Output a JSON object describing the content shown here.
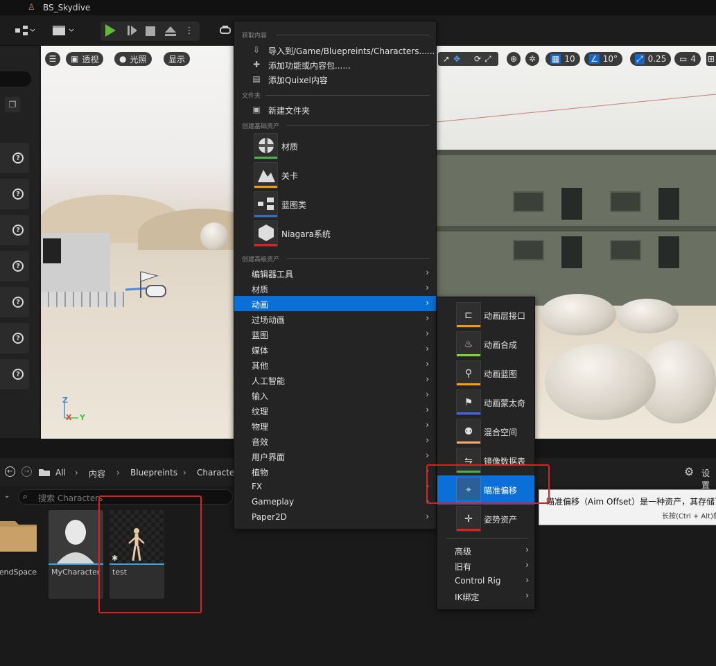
{
  "window": {
    "title": "BS_Skydive"
  },
  "viewport": {
    "menu_icon": "hamburger-icon",
    "perspective_label": "透视",
    "lighting_label": "光照",
    "show_label": "显示",
    "grid_value": "10",
    "angle_value": "10°",
    "scale_value": "0.25",
    "camera_value": "4",
    "axis_z": "Z",
    "axis_x": "X",
    "axis_y": "Y"
  },
  "content_browser": {
    "breadcrumb": [
      "All",
      "内容",
      "Bluepreints",
      "Characte"
    ],
    "settings_label": "设置",
    "search_placeholder": "搜索 Characters",
    "assets": [
      {
        "label": "BlendSpace"
      },
      {
        "label": "MyCharacter"
      },
      {
        "label": "test"
      }
    ]
  },
  "context_menu": {
    "section_get": "获取内容",
    "import_label": "导入到/Game/Bluepreints/Characters......",
    "add_feature_label": "添加功能或内容包......",
    "add_quixel_label": "添加Quixel内容",
    "section_folder": "文件夹",
    "new_folder_label": "新建文件夹",
    "section_basic": "创建基础资产",
    "basic_items": [
      {
        "label": "材质",
        "stripe": "#4caf50"
      },
      {
        "label": "关卡",
        "stripe": "#f39c12"
      },
      {
        "label": "蓝图类",
        "stripe": "#2f6fd0"
      },
      {
        "label": "Niagara系统",
        "stripe": "#e02020"
      }
    ],
    "section_advanced": "创建高级资产",
    "categories": [
      "编辑器工具",
      "材质",
      "动画",
      "过场动画",
      "蓝图",
      "媒体",
      "其他",
      "人工智能",
      "输入",
      "纹理",
      "物理",
      "音效",
      "用户界面",
      "植物",
      "FX",
      "Gameplay",
      "Paper2D"
    ],
    "highlighted_category": "动画"
  },
  "animation_submenu": {
    "items": [
      {
        "label": "动画层接口",
        "icon": "anim-layer-interface-icon",
        "stripe": "#f39c12"
      },
      {
        "label": "动画合成",
        "icon": "anim-composite-icon",
        "stripe": "#7fd32a"
      },
      {
        "label": "动画蓝图",
        "icon": "anim-blueprint-icon",
        "stripe": "#f39c12"
      },
      {
        "label": "动画蒙太奇",
        "icon": "anim-montage-icon",
        "stripe": "#4466ee"
      },
      {
        "label": "混合空间",
        "icon": "blend-space-icon",
        "stripe": "#f7a96b"
      },
      {
        "label": "镜像数据表",
        "icon": "mirror-table-icon",
        "stripe": "#4caf50"
      },
      {
        "label": "瞄准偏移",
        "icon": "aim-offset-icon",
        "stripe": "#0a70d8"
      },
      {
        "label": "姿势资产",
        "icon": "pose-asset-icon",
        "stripe": "#e02020"
      }
    ],
    "highlighted": "瞄准偏移",
    "more": [
      "高级",
      "旧有",
      "Control Rig",
      "IK绑定"
    ]
  },
  "tooltip": {
    "line1": "瞄准偏移（Aim Offset）是一种资产，其存储可",
    "line2": "长按(Ctrl + Alt)获"
  },
  "colors": {
    "accent": "#0a70d8",
    "annotation": "#e11d1d",
    "play": "#5fba3b"
  }
}
